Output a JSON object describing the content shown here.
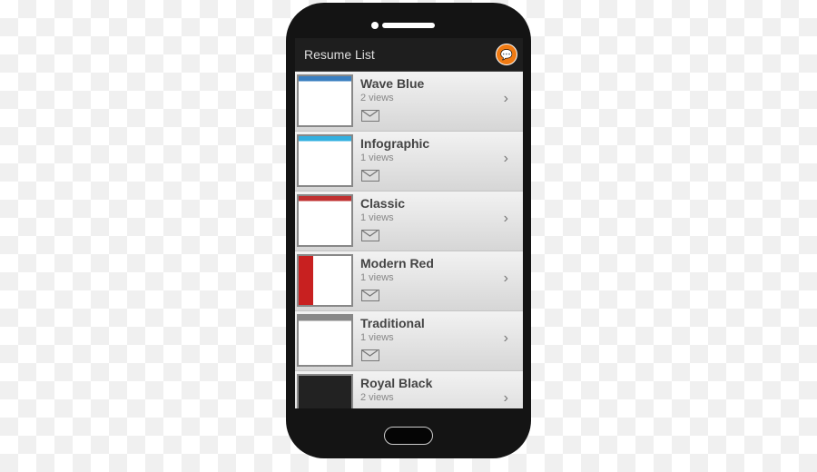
{
  "app": {
    "title": "Resume List",
    "action_icon": "chat-bubbles-icon",
    "accent": "#f07a12"
  },
  "resumes": [
    {
      "name": "Wave Blue",
      "views": "2 views",
      "thumb_color": "#3a7fc0"
    },
    {
      "name": "Infographic",
      "views": "1 views",
      "thumb_color": "#33b0e0"
    },
    {
      "name": "Classic",
      "views": "1 views",
      "thumb_color": "#c03030"
    },
    {
      "name": "Modern Red",
      "views": "1 views",
      "thumb_color": "#c82020"
    },
    {
      "name": "Traditional",
      "views": "1 views",
      "thumb_color": "#888888"
    },
    {
      "name": "Royal Black",
      "views": "2 views",
      "thumb_color": "#222222"
    }
  ]
}
